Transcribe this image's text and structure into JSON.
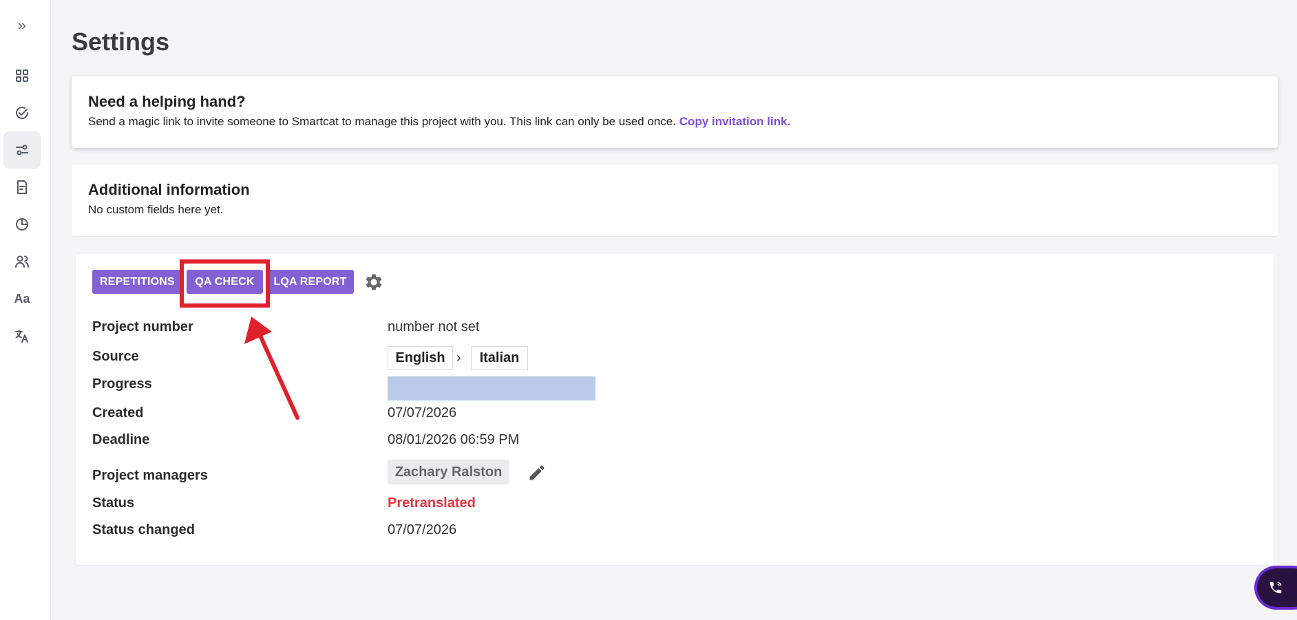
{
  "sidebar": {
    "expand_icon": "double-chevron-right-icon",
    "items": [
      {
        "name": "dashboard",
        "icon": "grid-icon"
      },
      {
        "name": "tasks",
        "icon": "check-circle-icon"
      },
      {
        "name": "settings",
        "icon": "sliders-icon",
        "active": true
      },
      {
        "name": "documents",
        "icon": "document-icon"
      },
      {
        "name": "statistics",
        "icon": "pie-chart-icon"
      },
      {
        "name": "team",
        "icon": "users-icon"
      },
      {
        "name": "glossary",
        "label": "Aa"
      },
      {
        "name": "translation-memory",
        "icon": "translate-icon"
      }
    ]
  },
  "page": {
    "title": "Settings"
  },
  "help_card": {
    "title": "Need a helping hand?",
    "text": "Send a magic link to invite someone to Smartcat to manage this project with you. This link can only be used once.",
    "link": "Copy invitation link."
  },
  "additional_card": {
    "title": "Additional information",
    "text": "No custom fields here yet."
  },
  "toolbar": {
    "repetitions": "REPETITIONS",
    "qa_check": "QA CHECK",
    "lqa_report": "LQA REPORT",
    "settings_icon": "gear-icon"
  },
  "details": {
    "project_number_label": "Project number",
    "project_number_value": "number not set",
    "source_label": "Source",
    "source_lang": "English",
    "target_lang": "Italian",
    "progress_label": "Progress",
    "created_label": "Created",
    "created_value": "07/07/2026",
    "deadline_label": "Deadline",
    "deadline_value": "08/01/2026 06:59 PM",
    "managers_label": "Project managers",
    "manager_name": "Zachary Ralston",
    "status_label": "Status",
    "status_value": "Pretranslated",
    "status_changed_label": "Status changed",
    "status_changed_value": "07/07/2026"
  },
  "colors": {
    "accent": "#8361d4",
    "link": "#7a4fd6",
    "status": "#e8343d",
    "annotation": "#e0202a",
    "progress": "#b9cbe8"
  }
}
